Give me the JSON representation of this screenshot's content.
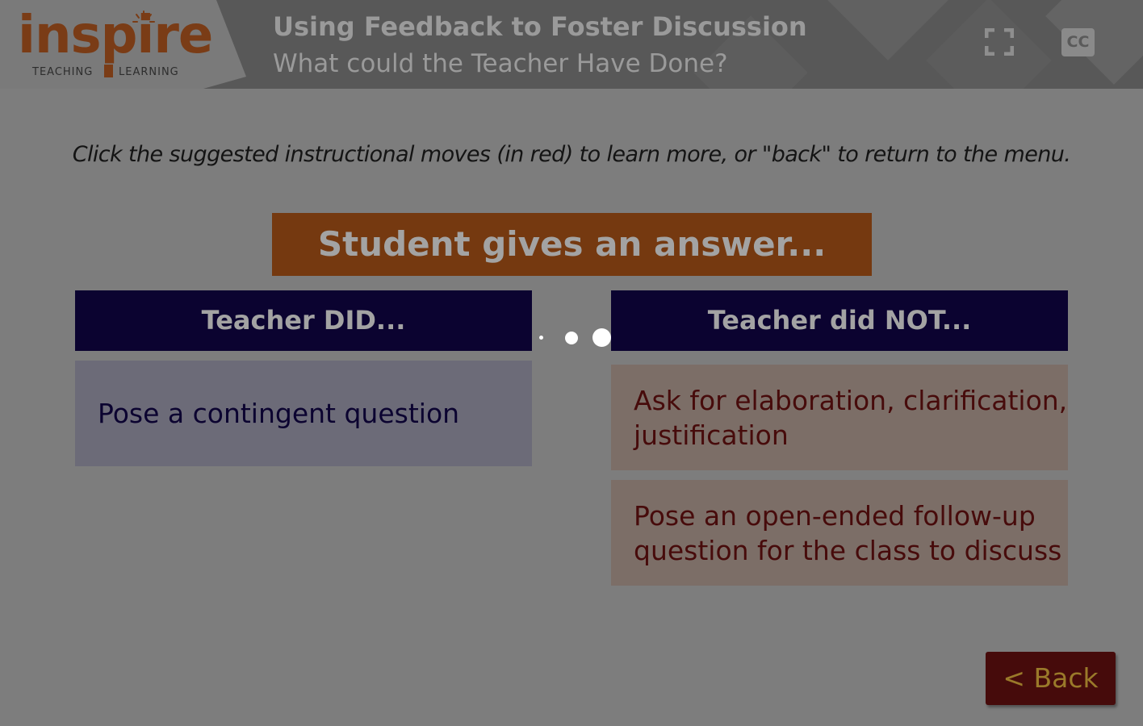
{
  "header": {
    "logo": {
      "word": "inspire",
      "sub_left": "TEACHING",
      "sub_right": "LEARNING"
    },
    "title": "Using Feedback to Foster Discussion",
    "subtitle": "What could the Teacher Have Done?",
    "fullscreen_icon": "fullscreen-icon",
    "cc_label": "CC"
  },
  "instruction": "Click the suggested instructional moves (in red) to learn more, or \"back\" to return to the menu.",
  "banner": "Student gives an answer...",
  "columns": {
    "did": {
      "heading": "Teacher DID...",
      "items": [
        "Pose a contingent question"
      ]
    },
    "did_not": {
      "heading": "Teacher did NOT...",
      "items": [
        "Ask for elaboration, clarification, justification",
        "Pose an open-ended follow-up question for the class to discuss"
      ]
    }
  },
  "back_label": "< Back",
  "colors": {
    "brand_orange": "#753910",
    "navy": "#0b0330",
    "maroon": "#460b0b",
    "overlay_gray": "#7d7d7d"
  }
}
